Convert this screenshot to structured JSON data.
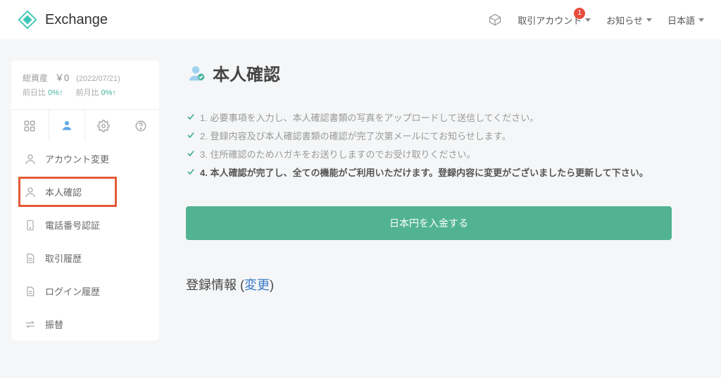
{
  "brand": {
    "name": "Exchange"
  },
  "header": {
    "account": {
      "label": "取引アカウント",
      "badge": "1"
    },
    "notice": {
      "label": "お知らせ"
    },
    "lang": {
      "label": "日本語"
    }
  },
  "assets": {
    "total_label": "総資産",
    "amount": "￥0",
    "date": "(2022/07/21)",
    "prev_day_label": "前日比",
    "prev_day_pct": "0%↑",
    "prev_month_label": "前月比",
    "prev_month_pct": "0%↑"
  },
  "menu": {
    "account_change": "アカウント変更",
    "identity": "本人確認",
    "phone": "電話番号認証",
    "tx_history": "取引履歴",
    "login_history": "ログイン履歴",
    "transfer": "振替"
  },
  "page": {
    "title": "本人確認",
    "steps": [
      "1. 必要事項を入力し、本人確認書類の写真をアップロードして送信してください。",
      "2. 登録内容及び本人確認書類の確認が完了次第メールにてお知らせします。",
      "3. 住所確認のためハガキをお送りしますのでお受け取りください。",
      "4. 本人確認が完了し、全ての機能がご利用いただけます。登録内容に変更がございましたら更新して下さい。"
    ],
    "cta": "日本円を入金する",
    "reg_info_label": "登録情報",
    "reg_change": "変更"
  }
}
